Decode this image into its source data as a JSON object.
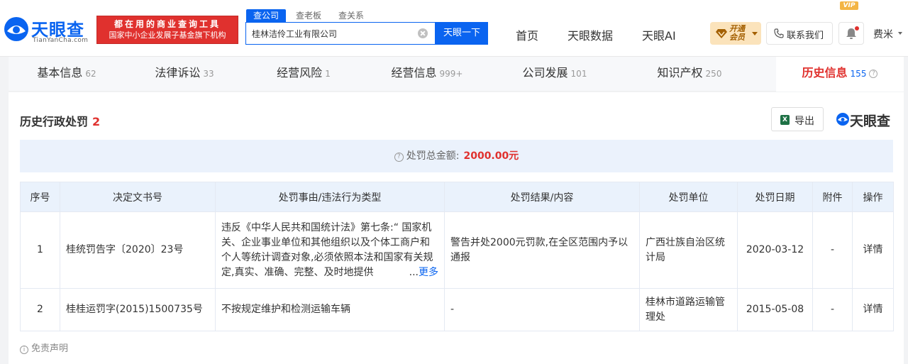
{
  "brand": {
    "name": "天眼查",
    "domain": "TianYanCha.com",
    "slogan_line1": "都在用的商业查询工具",
    "slogan_line2": "国家中小企业发展子基金旗下机构",
    "color": "#0a64f0"
  },
  "search": {
    "tabs": [
      {
        "label": "查公司",
        "active": true
      },
      {
        "label": "查老板",
        "active": false
      },
      {
        "label": "查关系",
        "active": false
      }
    ],
    "value": "桂林洁伶工业有限公司",
    "button_label": "天眼一下"
  },
  "nav": {
    "links": [
      "首页",
      "天眼数据",
      "天眼AI"
    ],
    "vip_label": "开通会员",
    "contact_label": "联系我们",
    "user_name": "费米"
  },
  "tabs": [
    {
      "label": "基本信息",
      "count": "62"
    },
    {
      "label": "法律诉讼",
      "count": "33"
    },
    {
      "label": "经营风险",
      "count": "1"
    },
    {
      "label": "经营信息",
      "count": "999+"
    },
    {
      "label": "公司发展",
      "count": "101"
    },
    {
      "label": "知识产权",
      "count": "250"
    },
    {
      "label": "历史信息",
      "count": "155",
      "active": true,
      "badge": "VIP"
    }
  ],
  "section": {
    "title": "历史行政处罚",
    "count": "2",
    "export_label": "导出",
    "summary_label": "处罚总金额:",
    "summary_amount": "2000.00元"
  },
  "table": {
    "headers": [
      "序号",
      "决定文书号",
      "处罚事由/违法行为类型",
      "处罚结果/内容",
      "处罚单位",
      "处罚日期",
      "附件",
      "操作"
    ],
    "rows": [
      {
        "index": "1",
        "doc_no": "桂统罚告字〔2020〕23号",
        "reason": "违反《中华人民共和国统计法》第七条:“ 国家机关、企业事业单位和其他组织以及个体工商户和个人等统计调查对象,必须依照本法和国家有关规定,真实、准确、完整、及时地提供",
        "more_label": "更多",
        "result": "警告并处2000元罚款,在全区范围内予以通报",
        "authority": "广西壮族自治区统计局",
        "date": "2020-03-12",
        "attachment": "-",
        "action": "详情"
      },
      {
        "index": "2",
        "doc_no": "桂桂运罚字(2015)1500735号",
        "reason": "不按规定维护和检测运输车辆",
        "result": "-",
        "authority": "桂林市道路运输管理处",
        "date": "2015-05-08",
        "attachment": "-",
        "action": "详情"
      }
    ]
  },
  "disclaimer": "免责声明"
}
